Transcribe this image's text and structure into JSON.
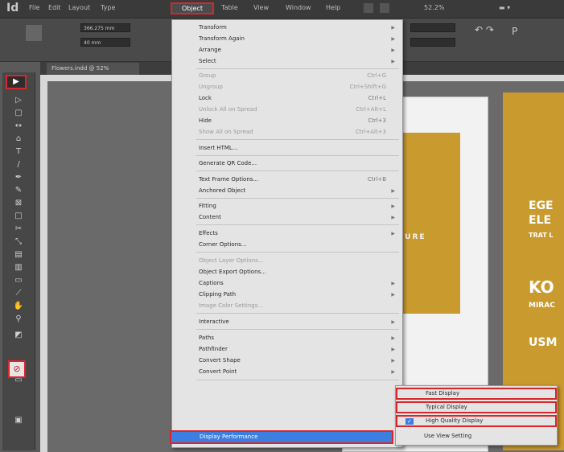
{
  "app": {
    "logo": "Id"
  },
  "menubar": {
    "items": [
      "File",
      "Edit",
      "Layout",
      "Type",
      "Object",
      "Table",
      "View",
      "Window",
      "Help"
    ],
    "zoom": "52.2%"
  },
  "control_panel": {
    "x": "366.275 mm",
    "y": "40 mm"
  },
  "document_tab": {
    "label": "Flowers.indd @ 52%"
  },
  "object_menu": {
    "items": [
      {
        "label": "Transform",
        "submenu": true
      },
      {
        "label": "Transform Again",
        "submenu": true
      },
      {
        "label": "Arrange",
        "submenu": true
      },
      {
        "label": "Select",
        "submenu": true
      },
      {
        "label": "Group",
        "shortcut": "Ctrl+G",
        "disabled": true
      },
      {
        "label": "Ungroup",
        "shortcut": "Ctrl+Shift+G",
        "disabled": true
      },
      {
        "label": "Lock",
        "shortcut": "Ctrl+L"
      },
      {
        "label": "Unlock All on Spread",
        "shortcut": "Ctrl+Alt+L",
        "disabled": true
      },
      {
        "label": "Hide",
        "shortcut": "Ctrl+3"
      },
      {
        "label": "Show All on Spread",
        "shortcut": "Ctrl+Alt+3",
        "disabled": true
      },
      {
        "label": "Insert HTML..."
      },
      {
        "label": "Generate QR Code..."
      },
      {
        "label": "Text Frame Options...",
        "shortcut": "Ctrl+B"
      },
      {
        "label": "Anchored Object",
        "submenu": true
      },
      {
        "label": "Fitting",
        "submenu": true
      },
      {
        "label": "Content",
        "submenu": true
      },
      {
        "label": "Effects",
        "submenu": true
      },
      {
        "label": "Corner Options..."
      },
      {
        "label": "Object Layer Options...",
        "disabled": true
      },
      {
        "label": "Object Export Options..."
      },
      {
        "label": "Captions",
        "submenu": true
      },
      {
        "label": "Clipping Path",
        "submenu": true
      },
      {
        "label": "Image Color Settings...",
        "disabled": true
      },
      {
        "label": "Interactive",
        "submenu": true
      },
      {
        "label": "Paths",
        "submenu": true
      },
      {
        "label": "Pathfinder",
        "submenu": true
      },
      {
        "label": "Convert Shape",
        "submenu": true
      },
      {
        "label": "Convert Point",
        "submenu": true
      }
    ],
    "highlighted": "Display Performance"
  },
  "submenu": {
    "items": [
      "Fast Display",
      "Typical Display",
      "High Quality Display",
      "Use View Setting"
    ],
    "checked": "High Quality Display"
  },
  "canvas": {
    "left_page_text": "TURE",
    "right_page_lines": [
      "EGE",
      "ELE",
      "TRAT L",
      "KO",
      "MIRAC",
      "USM"
    ]
  },
  "colors": {
    "highlight_border": "#d9262b",
    "menu_highlight": "#3d7fe0",
    "gold": "#c99a2e"
  }
}
